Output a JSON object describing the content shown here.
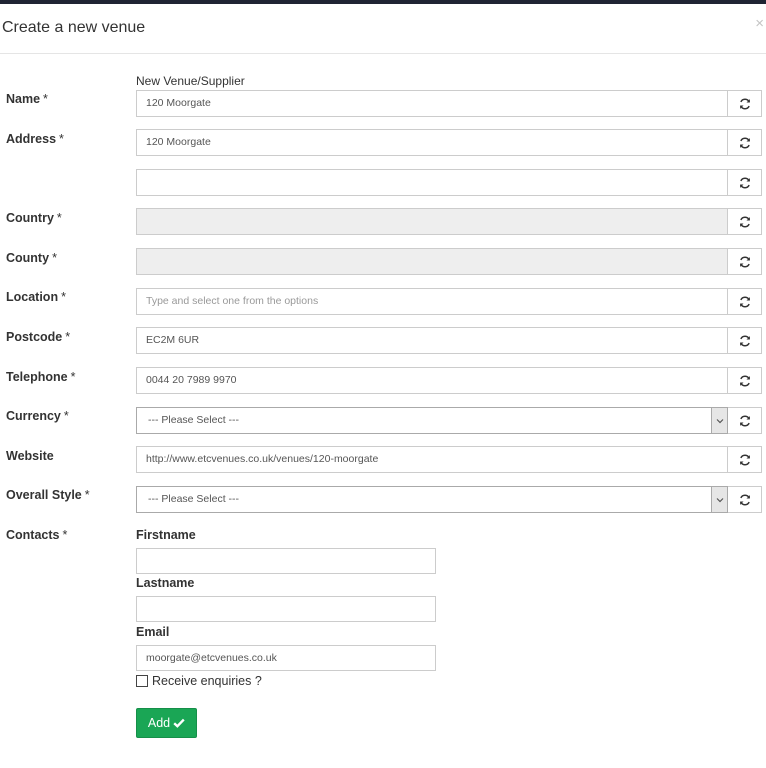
{
  "modal": {
    "title": "Create a new venue",
    "close_glyph": "×"
  },
  "hint": "New Venue/Supplier",
  "labels": {
    "name": "Name",
    "address": "Address",
    "country": "Country",
    "county": "County",
    "location": "Location",
    "postcode": "Postcode",
    "telephone": "Telephone",
    "currency": "Currency",
    "website": "Website",
    "overall_style": "Overall Style",
    "contacts": "Contacts",
    "required_mark": "*"
  },
  "fields": {
    "name": "120 Moorgate",
    "address1": "120 Moorgate",
    "address2": "",
    "country": "",
    "county": "",
    "location_placeholder": "Type and select one from the options",
    "postcode": "EC2M 6UR",
    "telephone": "0044 20 7989 9970",
    "currency": "--- Please Select ---",
    "website": "http://www.etcvenues.co.uk/venues/120-moorgate",
    "overall_style": "--- Please Select ---"
  },
  "contacts": {
    "firstname_label": "Firstname",
    "firstname": "",
    "lastname_label": "Lastname",
    "lastname": "",
    "email_label": "Email",
    "email": "moorgate@etcvenues.co.uk",
    "receive_enquiries_label": "Receive enquiries ?",
    "receive_enquiries_checked": false
  },
  "add_button": {
    "label": "Add",
    "icon": "check-icon"
  },
  "icons": {
    "refresh": "refresh-icon",
    "select_arrow": "chevron-down-icon"
  },
  "colors": {
    "accent": "#1aa655",
    "top_bar": "#1f2433",
    "disabled_bg": "#eeeeee"
  }
}
